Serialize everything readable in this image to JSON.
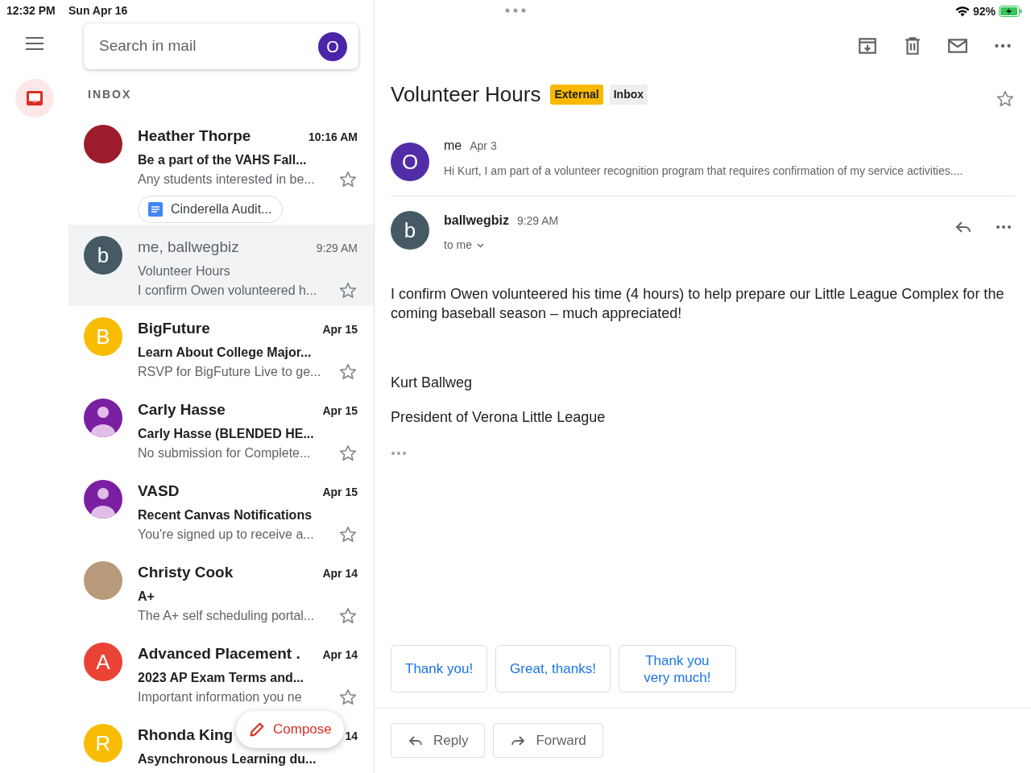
{
  "status_bar": {
    "time": "12:32 PM",
    "date": "Sun Apr 16",
    "battery": "92%"
  },
  "search": {
    "placeholder": "Search in mail",
    "account_letter": "O"
  },
  "list_label": "INBOX",
  "emails": [
    {
      "sender": "Heather Thorpe",
      "time": "10:16 AM",
      "subject": "Be a part of the VAHS Fall...",
      "preview": "Any students interested in be...",
      "unread": true,
      "selected": false,
      "avatar": {
        "kind": "photo",
        "color": "#9b1c2a"
      },
      "attachment": "Cinderella Audit..."
    },
    {
      "sender": "me, ballwegbiz",
      "time": "9:29 AM",
      "subject": "Volunteer Hours",
      "preview": "I confirm Owen volunteered h...",
      "unread": false,
      "selected": true,
      "avatar": {
        "kind": "letter",
        "letter": "b",
        "color": "#455a64"
      }
    },
    {
      "sender": "BigFuture",
      "time": "Apr 15",
      "subject": "Learn About College Major...",
      "preview": "RSVP for BigFuture Live to ge...",
      "unread": true,
      "selected": false,
      "avatar": {
        "kind": "letter",
        "letter": "B",
        "color": "#f9bc05"
      }
    },
    {
      "sender": "Carly Hasse",
      "time": "Apr 15",
      "subject": "Carly Hasse (BLENDED HE...",
      "preview": "No submission for Complete...",
      "unread": true,
      "selected": false,
      "avatar": {
        "kind": "person",
        "color": "#7b1fa2"
      }
    },
    {
      "sender": "VASD",
      "time": "Apr 15",
      "subject": "Recent Canvas Notifications",
      "preview": "You're signed up to receive a...",
      "unread": true,
      "selected": false,
      "avatar": {
        "kind": "person",
        "color": "#7b1fa2"
      }
    },
    {
      "sender": "Christy Cook",
      "time": "Apr 14",
      "subject": "A+",
      "preview": "The A+ self scheduling portal...",
      "unread": true,
      "selected": false,
      "avatar": {
        "kind": "photo",
        "color": "#b89a7a"
      }
    },
    {
      "sender": "Advanced Placement .",
      "time": "Apr 14",
      "subject": "2023 AP Exam Terms and...",
      "preview": "Important information you ne",
      "unread": true,
      "selected": false,
      "avatar": {
        "kind": "letter",
        "letter": "A",
        "color": "#ea4335"
      }
    },
    {
      "sender": "Rhonda King",
      "time": "14",
      "subject": "Asynchronous Learning du...",
      "unread": true,
      "selected": false,
      "avatar": {
        "kind": "letter",
        "letter": "R",
        "color": "#f9bc05"
      }
    }
  ],
  "compose": {
    "label": "Compose"
  },
  "thread": {
    "title": "Volunteer Hours",
    "labels": [
      {
        "text": "External",
        "color": "#f9b900"
      },
      {
        "text": "Inbox",
        "color": "#eeeeee"
      }
    ],
    "messages": [
      {
        "kind": "collapsed",
        "sender": "me",
        "date": "Apr 3",
        "snippet": "Hi Kurt, I am part of a volunteer recognition program that requires confirmation of my service activities....",
        "avatar": {
          "letter": "O",
          "color": "#512da8"
        }
      },
      {
        "kind": "expanded",
        "sender": "ballwegbiz",
        "date": "9:29 AM",
        "recipients": "to me",
        "avatar": {
          "letter": "b",
          "color": "#455a64"
        },
        "body": [
          "I confirm Owen volunteered his time (4 hours) to help prepare our Little League Complex for the coming baseball season – much appreciated!",
          "Kurt Ballweg",
          "President of Verona Little League"
        ]
      }
    ],
    "smart_replies": [
      "Thank you!",
      "Great, thanks!",
      "Thank you very much!"
    ],
    "actions": [
      {
        "kind": "reply",
        "label": "Reply"
      },
      {
        "kind": "forward",
        "label": "Forward"
      }
    ]
  }
}
